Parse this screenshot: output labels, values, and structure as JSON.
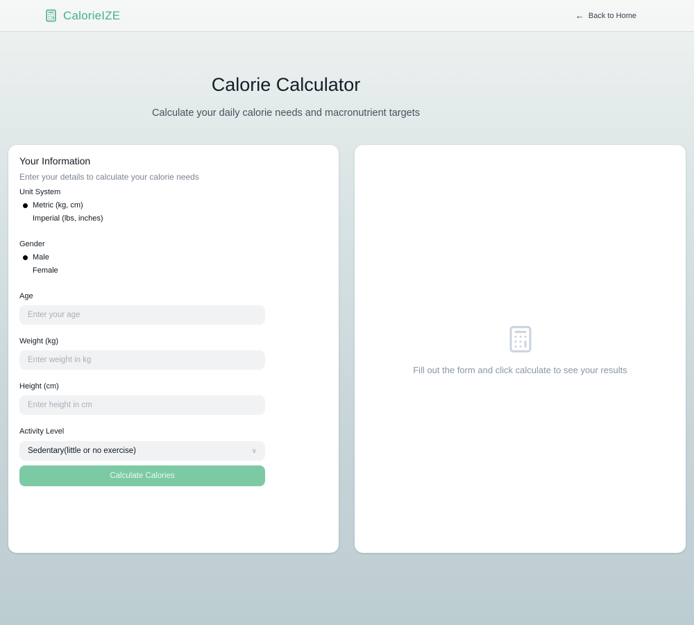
{
  "header": {
    "brand": "CalorieIZE",
    "back_arrow": "←",
    "back_label": "Back to Home"
  },
  "hero": {
    "title": "Calorie Calculator",
    "subtitle": "Calculate your daily calorie needs and macronutrient targets"
  },
  "form": {
    "title": "Your Information",
    "description": "Enter your details to calculate your calorie needs",
    "unit_system": {
      "label": "Unit System",
      "options": [
        {
          "label": "Metric (kg, cm)",
          "selected": true
        },
        {
          "label": "Imperial (lbs, inches)",
          "selected": false
        }
      ]
    },
    "gender": {
      "label": "Gender",
      "options": [
        {
          "label": "Male",
          "selected": true
        },
        {
          "label": "Female",
          "selected": false
        }
      ]
    },
    "age": {
      "label": "Age",
      "placeholder": "Enter your age",
      "value": ""
    },
    "weight": {
      "label": "Weight (kg)",
      "placeholder": "Enter weight in kg",
      "value": ""
    },
    "height": {
      "label": "Height (cm)",
      "placeholder": "Enter height in cm",
      "value": ""
    },
    "activity": {
      "label": "Activity Level",
      "selected_option": "Sedentary(little or no exercise)",
      "chevron": "∨"
    },
    "submit_label": "Calculate Calories"
  },
  "results": {
    "empty_icon": "calculator-icon",
    "empty_text": "Fill out the form and click calculate to see your results"
  },
  "colors": {
    "accent_green": "#45b08a",
    "button_green": "#7ccaa4",
    "empty_icon_gray": "#ccd5e0",
    "page_gradient_top": "#f1f4f2",
    "page_gradient_bottom": "#bccdd2"
  }
}
